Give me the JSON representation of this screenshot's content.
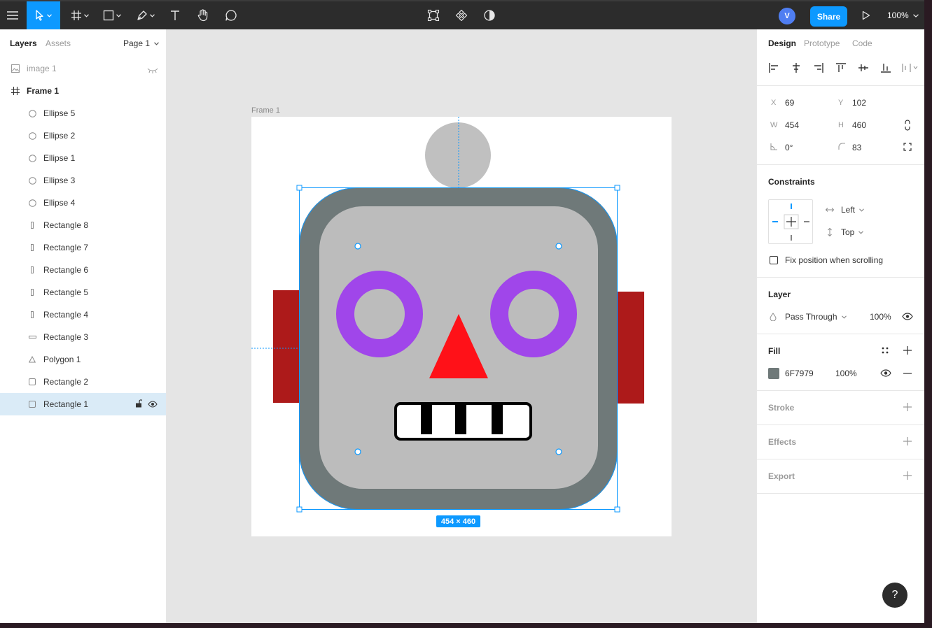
{
  "toolbar": {
    "share_label": "Share",
    "avatar_initial": "V",
    "zoom": "100%"
  },
  "left_panel": {
    "tabs": [
      {
        "label": "Layers"
      },
      {
        "label": "Assets"
      }
    ],
    "page": "Page 1",
    "layers": [
      {
        "name": "image 1",
        "icon": "image-icon"
      },
      {
        "name": "Frame 1",
        "icon": "frame-icon"
      },
      {
        "name": "Ellipse 5",
        "icon": "ellipse-icon"
      },
      {
        "name": "Ellipse 2",
        "icon": "ellipse-icon"
      },
      {
        "name": "Ellipse 1",
        "icon": "ellipse-icon"
      },
      {
        "name": "Ellipse 3",
        "icon": "ellipse-icon"
      },
      {
        "name": "Ellipse 4",
        "icon": "ellipse-icon"
      },
      {
        "name": "Rectangle 8",
        "icon": "rectangle-icon"
      },
      {
        "name": "Rectangle 7",
        "icon": "rectangle-icon"
      },
      {
        "name": "Rectangle 6",
        "icon": "rectangle-icon"
      },
      {
        "name": "Rectangle 5",
        "icon": "rectangle-icon"
      },
      {
        "name": "Rectangle 4",
        "icon": "rectangle-icon"
      },
      {
        "name": "Rectangle 3",
        "icon": "rectangle-icon"
      },
      {
        "name": "Polygon 1",
        "icon": "polygon-icon"
      },
      {
        "name": "Rectangle 2",
        "icon": "rectangle-icon"
      },
      {
        "name": "Rectangle 1",
        "icon": "rectangle-icon",
        "selected": true
      }
    ]
  },
  "canvas": {
    "frame_label": "Frame 1",
    "size_badge": "454 × 460"
  },
  "right_panel": {
    "tabs": [
      {
        "label": "Design"
      },
      {
        "label": "Prototype"
      },
      {
        "label": "Code"
      }
    ],
    "x_label": "X",
    "x": "69",
    "y_label": "Y",
    "y": "102",
    "w_label": "W",
    "w": "454",
    "h_label": "H",
    "h": "460",
    "rotation": "0°",
    "radius": "83",
    "constraints_title": "Constraints",
    "constraint_h": "Left",
    "constraint_v": "Top",
    "fix_position": "Fix position when scrolling",
    "layer_title": "Layer",
    "blend_mode": "Pass Through",
    "layer_opacity": "100%",
    "fill_title": "Fill",
    "fill_hex": "6F7979",
    "fill_opacity": "100%",
    "stroke_title": "Stroke",
    "effects_title": "Effects",
    "export_title": "Export"
  },
  "colors": {
    "accent": "#0d99ff",
    "head_outer": "#6f7979",
    "head_inner": "#bcbcbc",
    "ears": "#ad1a1a",
    "eyes": "#a046ea",
    "nose": "#ff1118",
    "antenna": "#c0c0c0"
  },
  "help_label": "?"
}
